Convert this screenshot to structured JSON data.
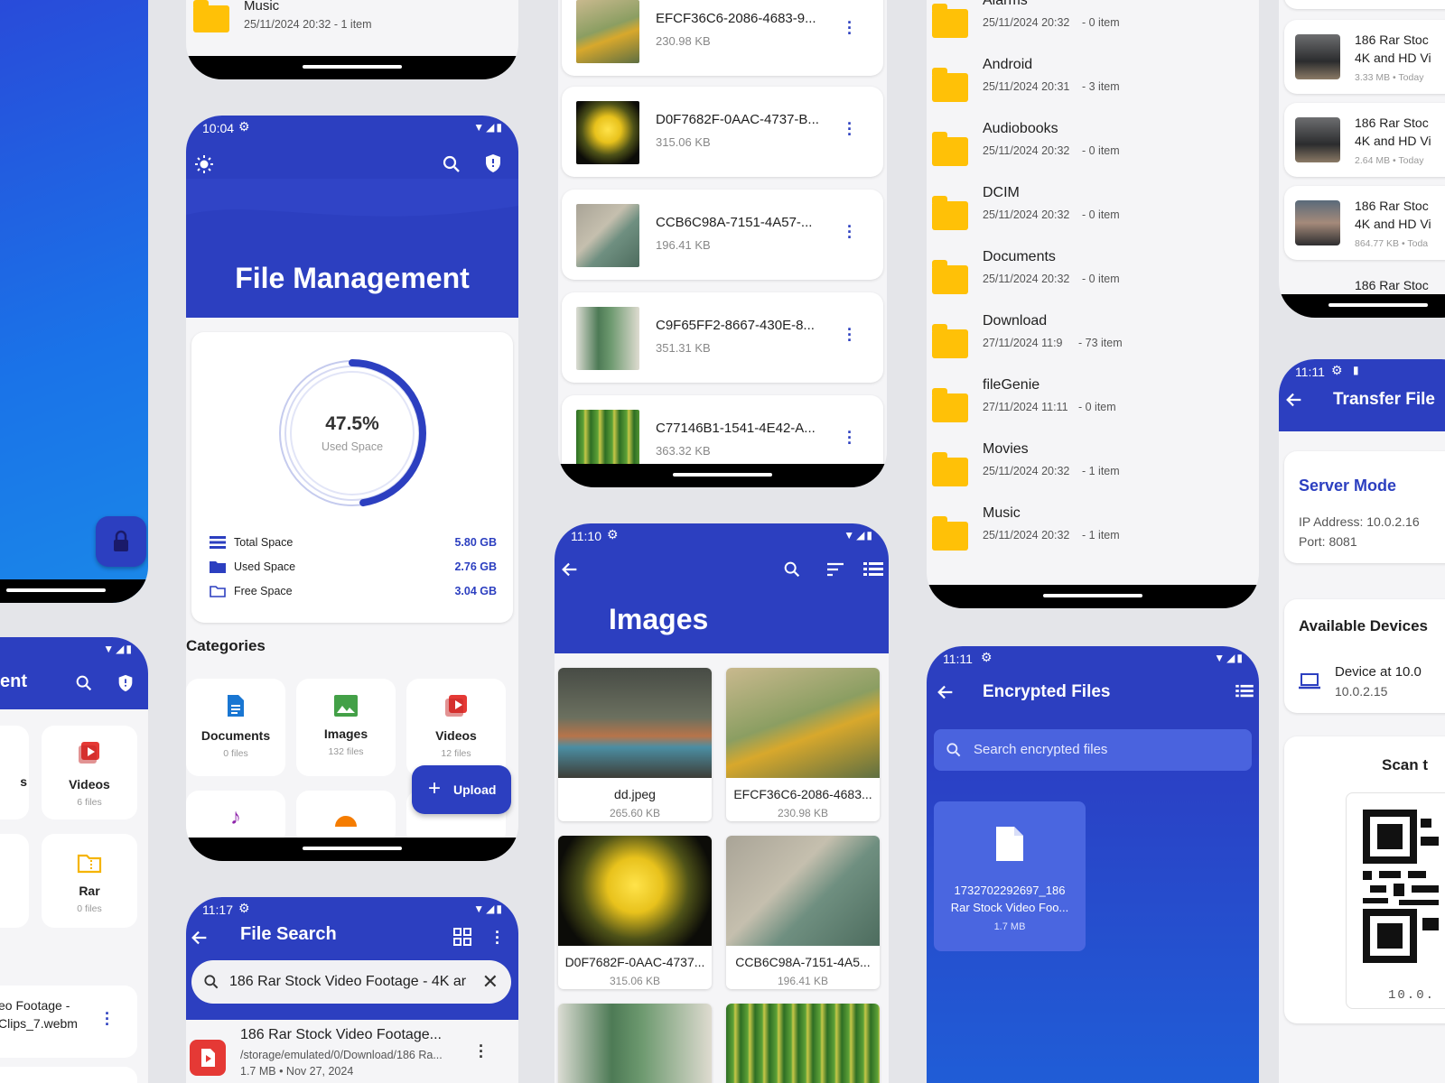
{
  "p1": {
    "fab_icon": "lock-icon"
  },
  "p2": {
    "title_partial": "ent",
    "categories": [
      {
        "name": "Videos",
        "count": "6 files"
      },
      {
        "name": "Rar",
        "count": "0 files"
      }
    ],
    "partial_label": "s",
    "file_line1": "eo Footage -",
    "file_line2": "Clips_7.webm"
  },
  "p3": {
    "title": "Music",
    "meta": "25/11/2024 20:32  - 1 item"
  },
  "p4": {
    "time": "10:04",
    "title": "File Management",
    "percent": "47.5%",
    "used_label": "Used Space",
    "used_fraction": 0.475,
    "stats": [
      {
        "label": "Total Space",
        "value": "5.80 GB"
      },
      {
        "label": "Used Space",
        "value": "2.76 GB"
      },
      {
        "label": "Free Space",
        "value": "3.04 GB"
      }
    ],
    "categories_heading": "Categories",
    "categories": [
      {
        "name": "Documents",
        "count": "0 files"
      },
      {
        "name": "Images",
        "count": "132 files"
      },
      {
        "name": "Videos",
        "count": "12 files"
      }
    ],
    "upload_label": "Upload"
  },
  "p5": {
    "time": "11:17",
    "title": "File Search",
    "query": "186 Rar Stock Video Footage - 4K ar",
    "result_name": "186 Rar Stock Video Footage...",
    "result_path": "/storage/emulated/0/Download/186 Ra...",
    "result_meta": "1.7 MB • Nov 27, 2024"
  },
  "p6": {
    "files": [
      {
        "name": "EFCF36C6-2086-4683-9...",
        "size": "230.98 KB"
      },
      {
        "name": "D0F7682F-0AAC-4737-B...",
        "size": "315.06 KB"
      },
      {
        "name": "CCB6C98A-7151-4A57-...",
        "size": "196.41 KB"
      },
      {
        "name": "C9F65FF2-8667-430E-8...",
        "size": "351.31 KB"
      },
      {
        "name": "C77146B1-1541-4E42-A...",
        "size": "363.32 KB"
      }
    ]
  },
  "p7": {
    "time": "11:10",
    "title": "Images",
    "images": [
      {
        "name": "dd.jpeg",
        "size": "265.60 KB"
      },
      {
        "name": "EFCF36C6-2086-4683...",
        "size": "230.98 KB"
      },
      {
        "name": "D0F7682F-0AAC-4737...",
        "size": "315.06 KB"
      },
      {
        "name": "CCB6C98A-7151-4A5...",
        "size": "196.41 KB"
      }
    ]
  },
  "p8": {
    "folders": [
      {
        "name": "Alarms",
        "date": "25/11/2024 20:32",
        "items": "- 0 item"
      },
      {
        "name": "Android",
        "date": "25/11/2024 20:31",
        "items": "- 3 item"
      },
      {
        "name": "Audiobooks",
        "date": "25/11/2024 20:32",
        "items": "- 0 item"
      },
      {
        "name": "DCIM",
        "date": "25/11/2024 20:32",
        "items": "- 0 item"
      },
      {
        "name": "Documents",
        "date": "25/11/2024 20:32",
        "items": "- 0 item"
      },
      {
        "name": "Download",
        "date": "27/11/2024 11:9",
        "items": "- 73 item"
      },
      {
        "name": "fileGenie",
        "date": "27/11/2024 11:11",
        "items": "- 0 item"
      },
      {
        "name": "Movies",
        "date": "25/11/2024 20:32",
        "items": "- 1 item"
      },
      {
        "name": "Music",
        "date": "25/11/2024 20:32",
        "items": "- 1 item"
      }
    ]
  },
  "p9": {
    "time": "11:11",
    "title": "Encrypted Files",
    "search_placeholder": "Search encrypted files",
    "file_line1": "1732702292697_186",
    "file_line2": "Rar Stock Video Foo...",
    "file_size": "1.7 MB"
  },
  "p10": {
    "items": [
      {
        "line1": "186 Rar Stoc",
        "line2": "4K and HD Vi",
        "meta": "3.33 MB • Today"
      },
      {
        "line1": "186 Rar Stoc",
        "line2": "4K and HD Vi",
        "meta": "2.64 MB • Today"
      },
      {
        "line1": "186 Rar Stoc",
        "line2": "4K and HD Vi",
        "meta": "864.77 KB • Toda"
      }
    ],
    "last_line": "186 Rar Stoc"
  },
  "p11": {
    "time": "11:11",
    "title": "Transfer File",
    "server_mode": "Server Mode",
    "ip": "IP Address: 10.0.2.16",
    "port": "Port: 8081",
    "available_heading": "Available Devices",
    "device_name": "Device at 10.0",
    "device_ip": "10.0.2.15",
    "scan_title": "Scan t",
    "qr_caption": "10.0."
  },
  "colors": {
    "accent": "#2c3fc0",
    "folder": "#ffc107",
    "danger": "#e53935"
  }
}
